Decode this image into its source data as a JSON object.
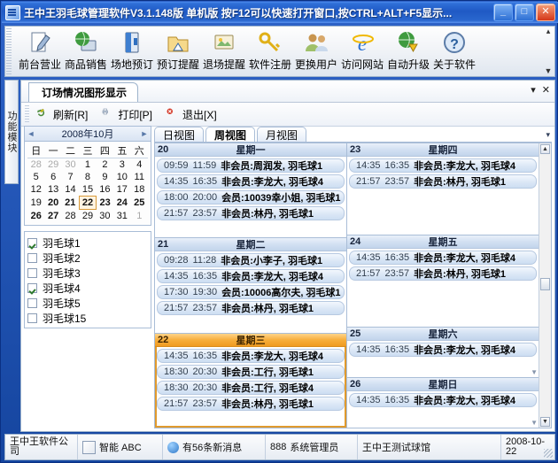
{
  "window": {
    "title": "王中王羽毛球管理软件V3.1.148版  单机版  按F12可以快速打开窗口,按CTRL+ALT+F5显示...",
    "minimize": "_",
    "maximize": "□",
    "close": "✕"
  },
  "toolbar": {
    "items": [
      {
        "label": "前台营业",
        "icon": "note-pencil-icon"
      },
      {
        "label": "商品销售",
        "icon": "globe-screen-icon"
      },
      {
        "label": "场地预订",
        "icon": "book-blue-icon"
      },
      {
        "label": "预订提醒",
        "icon": "folder-alert-icon"
      },
      {
        "label": "退场提醒",
        "icon": "picture-exit-icon"
      },
      {
        "label": "软件注册",
        "icon": "key-icon"
      },
      {
        "label": "更换用户",
        "icon": "users-icon"
      },
      {
        "label": "访问网站",
        "icon": "internet-explorer-icon"
      },
      {
        "label": "自动升级",
        "icon": "globe-download-icon"
      },
      {
        "label": "关于软件",
        "icon": "question-help-icon"
      }
    ],
    "scroll_up": "▴",
    "scroll_down": "▼"
  },
  "side_tab": {
    "label": "功能模块"
  },
  "child_window": {
    "tab_title": "订场情况图形显示",
    "menu_arrow": "▾",
    "close": "✕",
    "tools": [
      {
        "label": "刷新[R]",
        "icon": "refresh-icon"
      },
      {
        "label": "打印[P]",
        "icon": "print-icon"
      },
      {
        "label": "退出[X]",
        "icon": "exit-icon"
      }
    ]
  },
  "calendar": {
    "prev_arrow": "◄",
    "next_arrow": "►",
    "title": "2008年10月",
    "weekdays": [
      "日",
      "一",
      "二",
      "三",
      "四",
      "五",
      "六"
    ],
    "weeks": [
      [
        {
          "d": "28",
          "style": "other"
        },
        {
          "d": "29",
          "style": "other"
        },
        {
          "d": "30",
          "style": "other"
        },
        {
          "d": "1",
          "style": ""
        },
        {
          "d": "2",
          "style": ""
        },
        {
          "d": "3",
          "style": ""
        },
        {
          "d": "4",
          "style": ""
        }
      ],
      [
        {
          "d": "5",
          "style": ""
        },
        {
          "d": "6",
          "style": ""
        },
        {
          "d": "7",
          "style": ""
        },
        {
          "d": "8",
          "style": ""
        },
        {
          "d": "9",
          "style": ""
        },
        {
          "d": "10",
          "style": ""
        },
        {
          "d": "11",
          "style": ""
        }
      ],
      [
        {
          "d": "12",
          "style": ""
        },
        {
          "d": "13",
          "style": ""
        },
        {
          "d": "14",
          "style": ""
        },
        {
          "d": "15",
          "style": ""
        },
        {
          "d": "16",
          "style": ""
        },
        {
          "d": "17",
          "style": ""
        },
        {
          "d": "18",
          "style": ""
        }
      ],
      [
        {
          "d": "19",
          "style": ""
        },
        {
          "d": "20",
          "style": "bold"
        },
        {
          "d": "21",
          "style": "bold"
        },
        {
          "d": "22",
          "style": "sel"
        },
        {
          "d": "23",
          "style": "bold"
        },
        {
          "d": "24",
          "style": "bold"
        },
        {
          "d": "25",
          "style": "bold"
        }
      ],
      [
        {
          "d": "26",
          "style": "bold"
        },
        {
          "d": "27",
          "style": "bold"
        },
        {
          "d": "28",
          "style": ""
        },
        {
          "d": "29",
          "style": ""
        },
        {
          "d": "30",
          "style": ""
        },
        {
          "d": "31",
          "style": ""
        },
        {
          "d": "1",
          "style": "other"
        }
      ]
    ]
  },
  "courts": [
    {
      "label": "羽毛球1",
      "checked": true
    },
    {
      "label": "羽毛球2",
      "checked": false
    },
    {
      "label": "羽毛球3",
      "checked": false
    },
    {
      "label": "羽毛球4",
      "checked": true
    },
    {
      "label": "羽毛球5",
      "checked": false
    },
    {
      "label": "羽毛球15",
      "checked": false
    }
  ],
  "view_tabs": [
    {
      "label": "日视图",
      "active": false
    },
    {
      "label": "周视图",
      "active": true
    },
    {
      "label": "月视图",
      "active": false
    }
  ],
  "view_tabs_more": "▾",
  "week": {
    "left_column": [
      {
        "day": "20",
        "weekday": "星期一",
        "selected": false,
        "appointments": [
          {
            "start": "09:59",
            "end": "11:59",
            "detail": "非会员:周润发, 羽毛球1"
          },
          {
            "start": "14:35",
            "end": "16:35",
            "detail": "非会员:李龙大, 羽毛球4"
          },
          {
            "start": "18:00",
            "end": "20:00",
            "detail": "会员:10039幸小姐, 羽毛球1"
          },
          {
            "start": "21:57",
            "end": "23:57",
            "detail": "非会员:林丹, 羽毛球1"
          }
        ]
      },
      {
        "day": "21",
        "weekday": "星期二",
        "selected": false,
        "appointments": [
          {
            "start": "09:28",
            "end": "11:28",
            "detail": "非会员:小李子, 羽毛球1"
          },
          {
            "start": "14:35",
            "end": "16:35",
            "detail": "非会员:李龙大, 羽毛球4"
          },
          {
            "start": "17:30",
            "end": "19:30",
            "detail": "会员:10006高尔夫, 羽毛球1"
          },
          {
            "start": "21:57",
            "end": "23:57",
            "detail": "非会员:林丹, 羽毛球1"
          }
        ]
      },
      {
        "day": "22",
        "weekday": "星期三",
        "selected": true,
        "appointments": [
          {
            "start": "14:35",
            "end": "16:35",
            "detail": "非会员:李龙大, 羽毛球4"
          },
          {
            "start": "18:30",
            "end": "20:30",
            "detail": "非会员:工行, 羽毛球1"
          },
          {
            "start": "18:30",
            "end": "20:30",
            "detail": "非会员:工行, 羽毛球4"
          },
          {
            "start": "21:57",
            "end": "23:57",
            "detail": "非会员:林丹, 羽毛球1"
          }
        ]
      }
    ],
    "right_column": [
      {
        "day": "23",
        "weekday": "星期四",
        "selected": false,
        "appointments": [
          {
            "start": "14:35",
            "end": "16:35",
            "detail": "非会员:李龙大, 羽毛球4"
          },
          {
            "start": "21:57",
            "end": "23:57",
            "detail": "非会员:林丹, 羽毛球1"
          }
        ]
      },
      {
        "day": "24",
        "weekday": "星期五",
        "selected": false,
        "appointments": [
          {
            "start": "14:35",
            "end": "16:35",
            "detail": "非会员:李龙大, 羽毛球4"
          },
          {
            "start": "21:57",
            "end": "23:57",
            "detail": "非会员:林丹, 羽毛球1"
          }
        ]
      },
      {
        "day": "25",
        "weekday": "星期六",
        "selected": false,
        "appointments": [
          {
            "start": "14:35",
            "end": "16:35",
            "detail": "非会员:李龙大, 羽毛球4"
          }
        ]
      },
      {
        "day": "26",
        "weekday": "星期日",
        "selected": false,
        "appointments": [
          {
            "start": "14:35",
            "end": "16:35",
            "detail": "非会员:李龙大, 羽毛球4"
          }
        ]
      }
    ]
  },
  "statusbar": {
    "company": "王中王软件公司",
    "ime": "智能 ABC",
    "messages": "有56条新消息",
    "operator_id": "888",
    "operator_name": "系统管理员",
    "venue": "王中王测试球馆",
    "date": "2008-10-22"
  },
  "colors": {
    "titlebar": "#1f59c4",
    "selected_day": "#f7ae3c",
    "appointment": "#dbe7f6",
    "accent": "#2f6fd8"
  }
}
